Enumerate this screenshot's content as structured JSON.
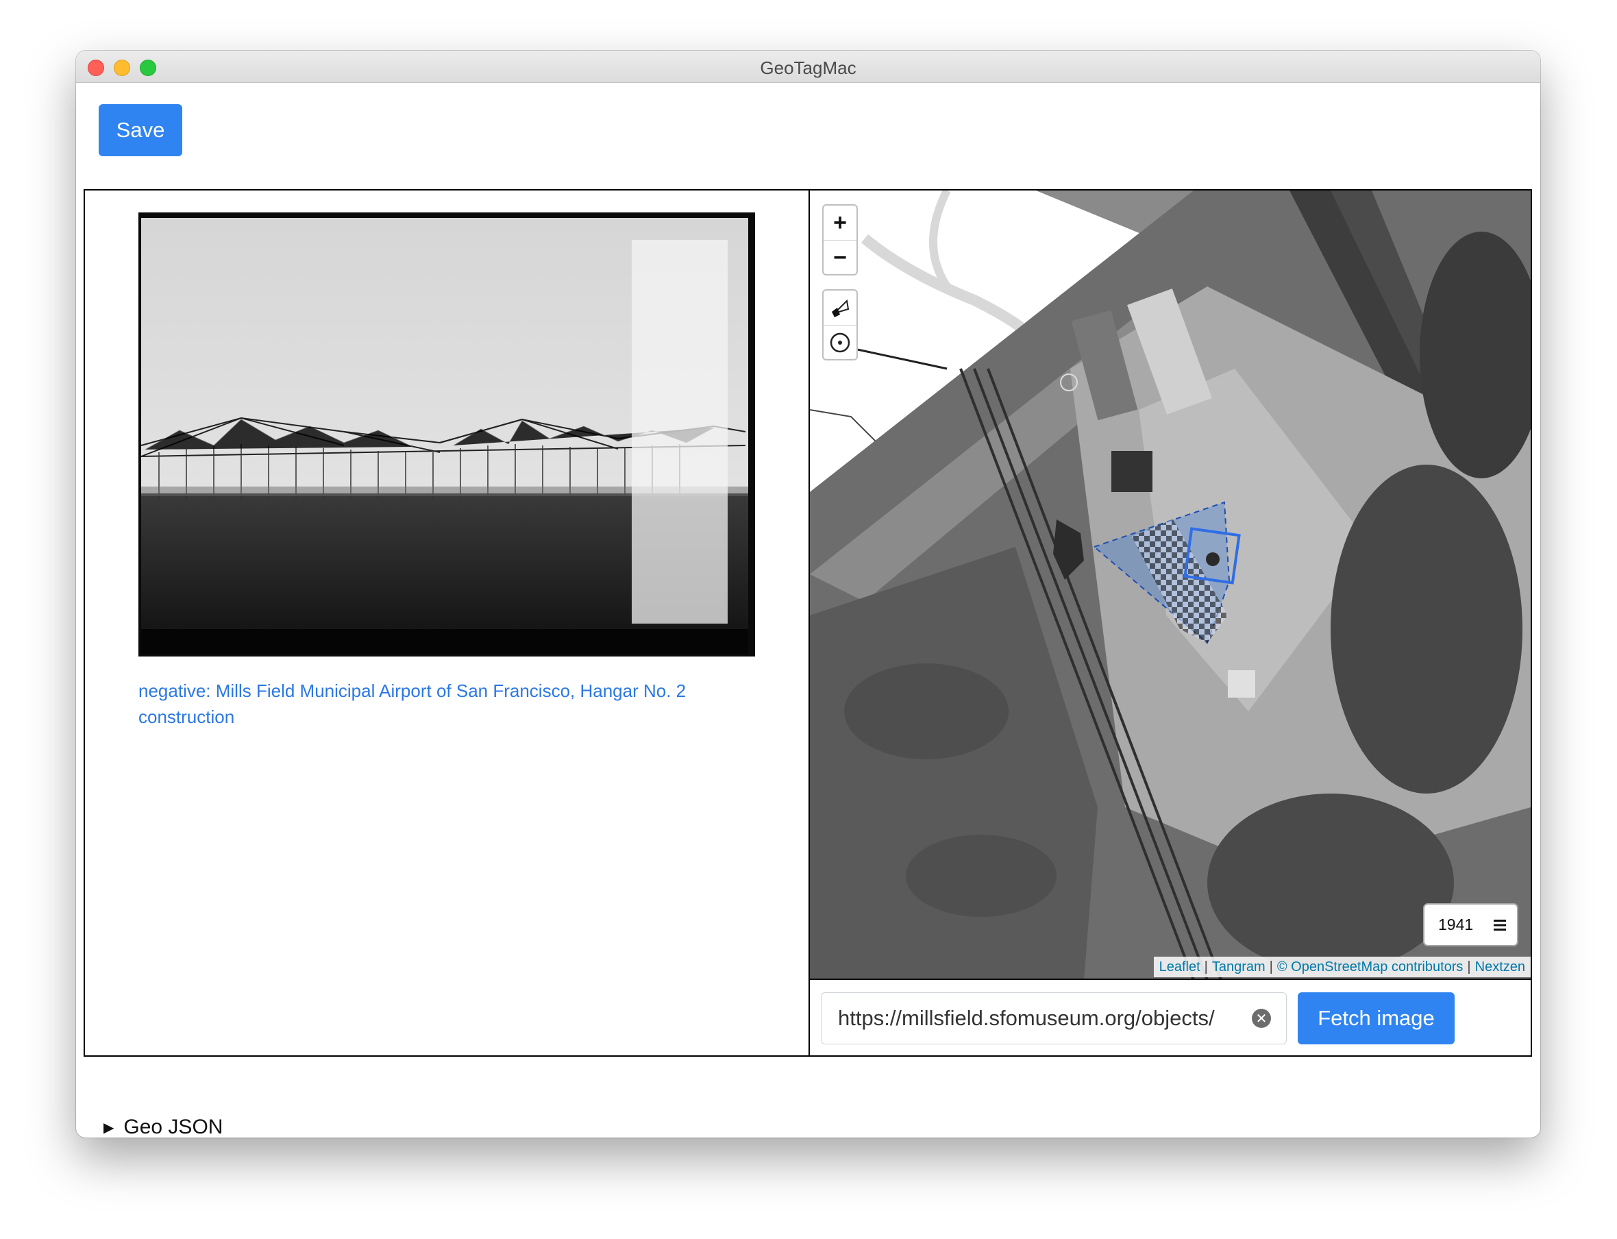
{
  "window": {
    "title": "GeoTagMac"
  },
  "toolbar": {
    "save_label": "Save"
  },
  "photo": {
    "caption": "negative: Mills Field Municipal Airport of San Francisco, Hangar No. 2 construction"
  },
  "map": {
    "zoom_in": "+",
    "zoom_out": "−",
    "layer_year": "1941",
    "attribution": {
      "leaflet": "Leaflet",
      "tangram": "Tangram",
      "osm": "© OpenStreetMap contributors",
      "nextzen": "Nextzen",
      "sep": "|"
    }
  },
  "fetch": {
    "url_value": "https://millsfield.sfomuseum.org/objects/",
    "button_label": "Fetch image"
  },
  "geojson": {
    "label": "Geo JSON"
  }
}
